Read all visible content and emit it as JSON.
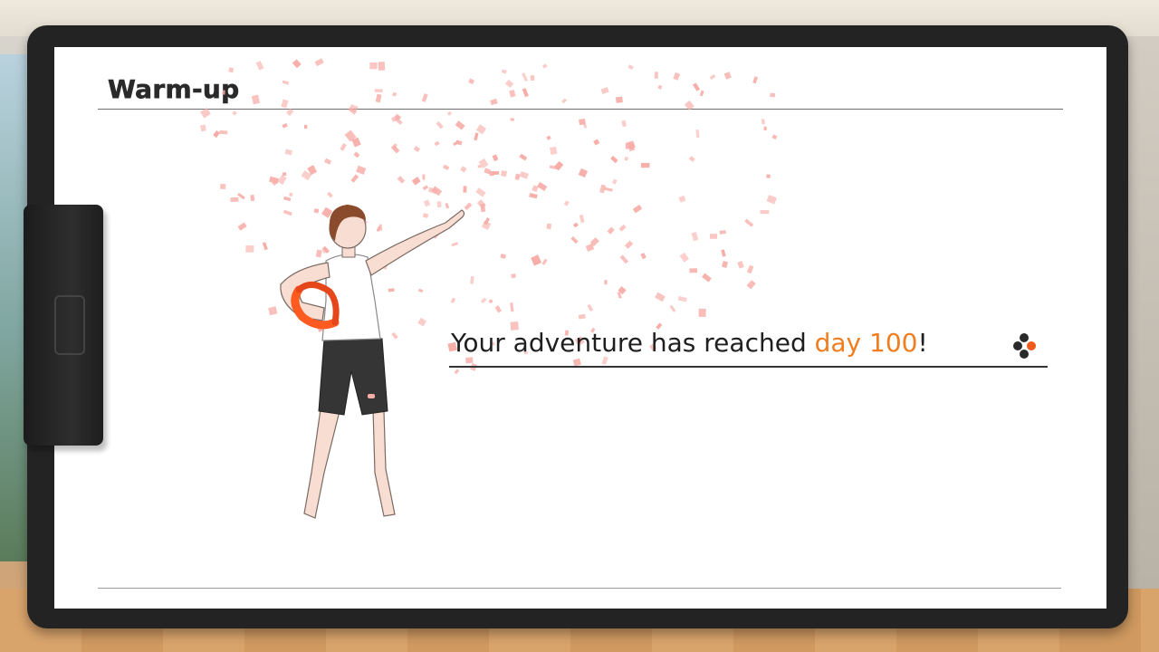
{
  "screen": {
    "title": "Warm-up",
    "message": {
      "prefix": "Your adventure has reached ",
      "highlight": "day 100",
      "suffix": "!"
    }
  },
  "colors": {
    "accent": "#f07d20",
    "confetti": "#f7aca7",
    "frame": "#232323",
    "ring": "#ff5a1f"
  },
  "icons": {
    "advance": "advance-dots-icon"
  }
}
